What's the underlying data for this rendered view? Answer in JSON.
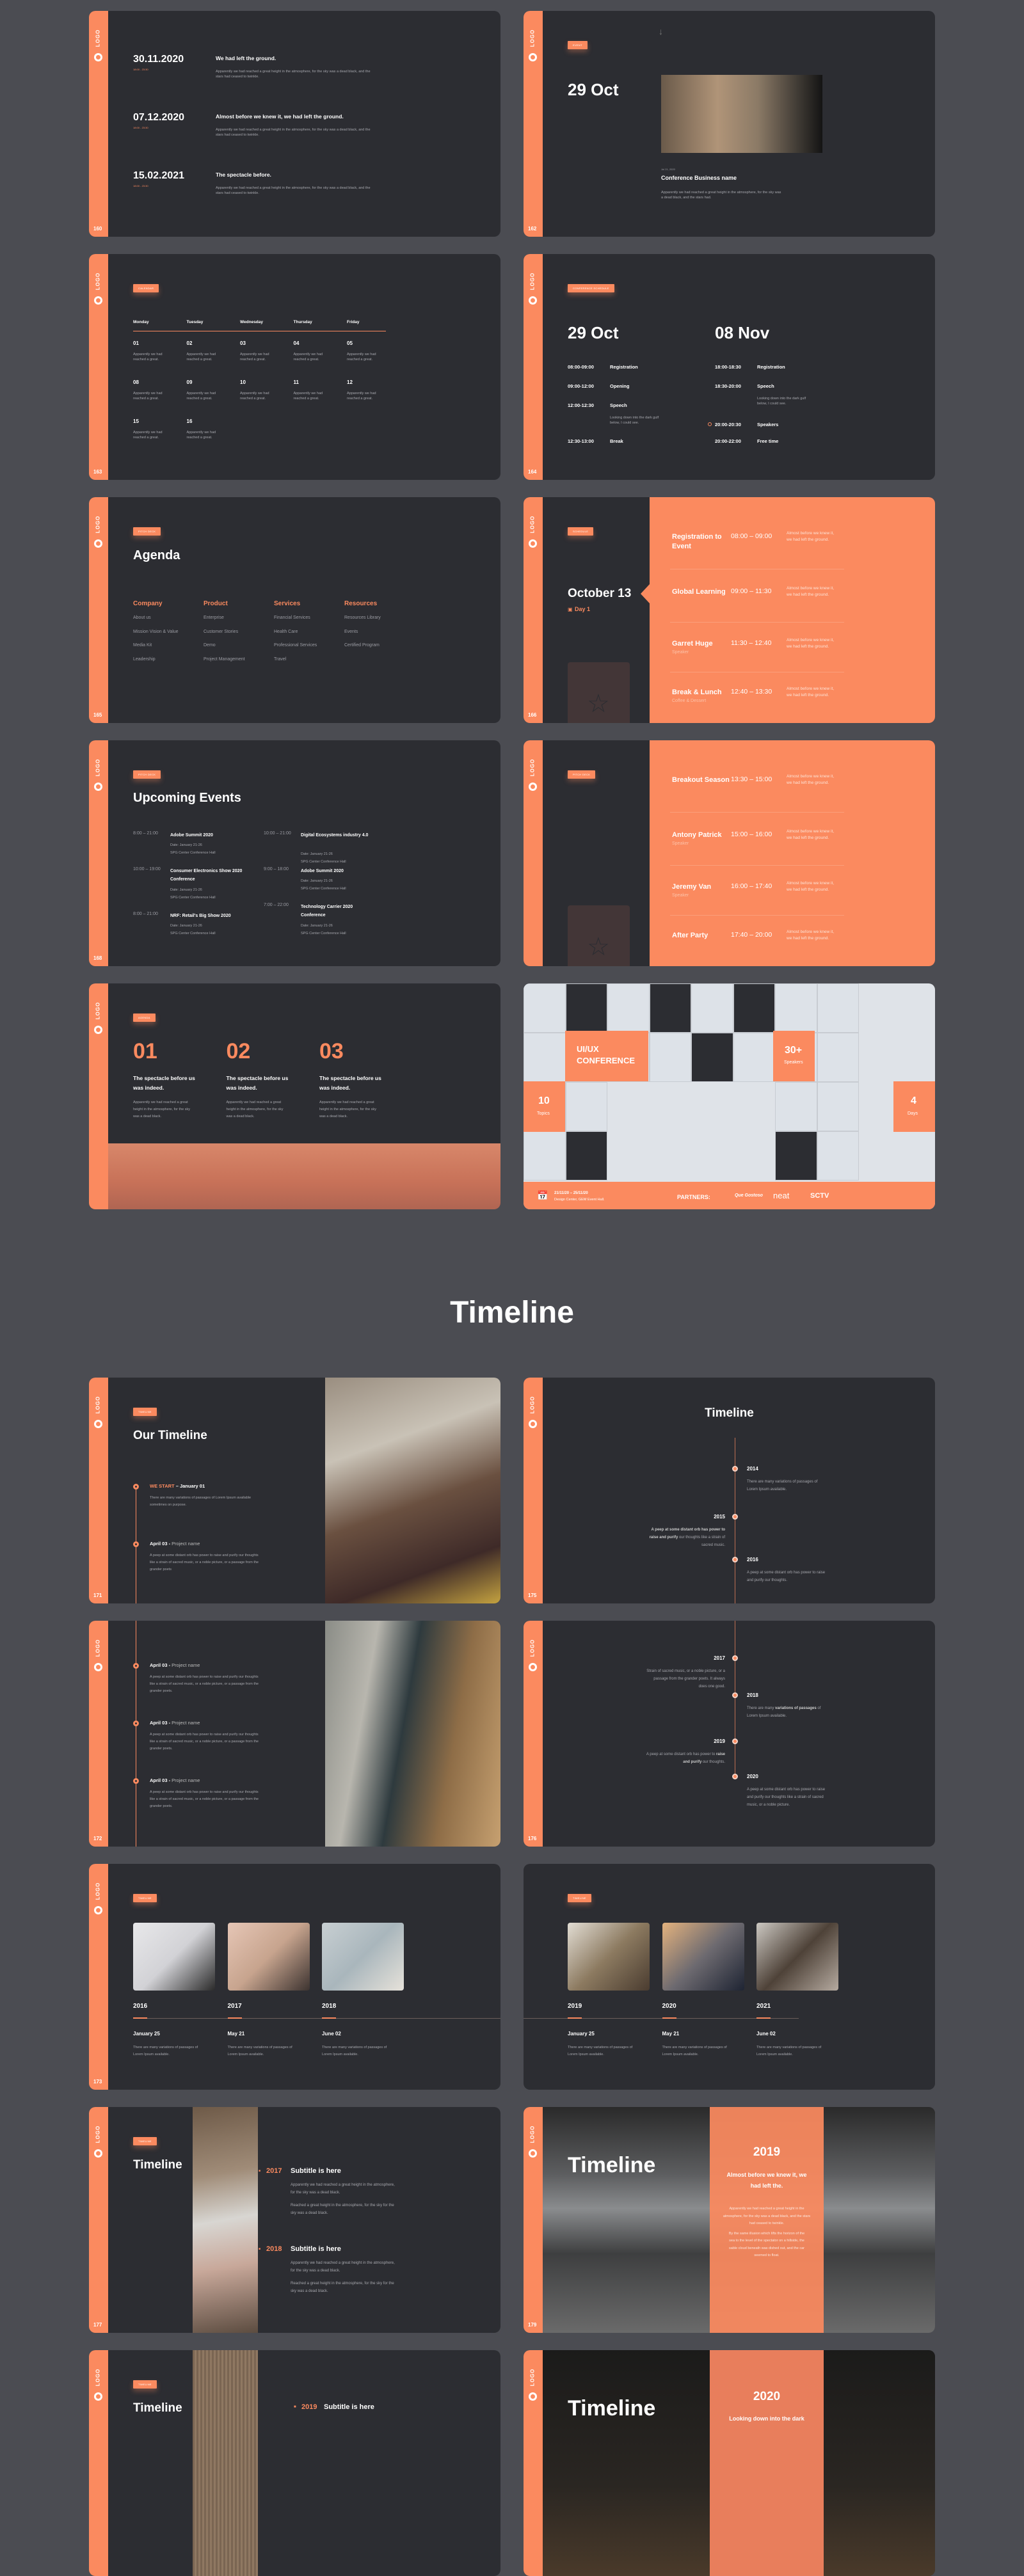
{
  "common": {
    "logo_text": "LOGO",
    "accent": "#fb8a5f",
    "bg_dark": "#2c2d32",
    "page_bg": "#4b4c52"
  },
  "s160": {
    "page": "160",
    "items": [
      {
        "date": "30.11.2020",
        "time": "18:00 - 23:30",
        "title": "We had left the ground.",
        "text": "Apparently we had reached a great height in the atmosphere, for the sky was a dead black, and the stars had ceased to twinkle."
      },
      {
        "date": "07.12.2020",
        "time": "18:00 - 23:30",
        "title": "Almost before we knew it, we had left the ground.",
        "text": "Apparently we had reached a great height in the atmosphere, for the sky was a dead black, and the stars had ceased to twinkle."
      },
      {
        "date": "15.02.2021",
        "time": "18:00 - 23:30",
        "title": "The spectacle  before.",
        "text": "Apparently we had reached a great height in the atmosphere, for the sky was a dead black, and the stars had ceased to twinkle."
      }
    ]
  },
  "s162": {
    "page": "162",
    "tag": "EVENT",
    "date": "29 Oct",
    "meta": "Jul 21, 2020",
    "title": "Conference Business name",
    "text": "Apparently we had reached a great height in the atmosphere, for the sky was a dead black, and the stars had."
  },
  "s163": {
    "page": "163",
    "tag": "CALENDAR",
    "days": [
      "Monday",
      "Tuesday",
      "Wednesday",
      "Thursday",
      "Friday"
    ],
    "cells": [
      {
        "n": "01",
        "t": "Apparently we had reached a great."
      },
      {
        "n": "02",
        "t": "Apparently we had reached a great."
      },
      {
        "n": "03",
        "t": "Apparently we had reached a great."
      },
      {
        "n": "04",
        "t": "Apparently we had reached a great."
      },
      {
        "n": "05",
        "t": "Apparently we had reached a great."
      },
      {
        "n": "08",
        "t": "Apparently we had reached a great."
      },
      {
        "n": "09",
        "t": "Apparently we had reached a great."
      },
      {
        "n": "10",
        "t": "Apparently we had reached a great."
      },
      {
        "n": "11",
        "t": "Apparently we had reached a great."
      },
      {
        "n": "12",
        "t": "Apparently we had reached a great."
      },
      {
        "n": "15",
        "t": "Apparently we had reached a great."
      },
      {
        "n": "16",
        "t": "Apparently we had reached a great."
      }
    ]
  },
  "s164": {
    "page": "164",
    "tag": "CONFERENCE SCHEDULE",
    "left": {
      "date": "29 Oct",
      "rows": [
        {
          "time": "08:00-09:00",
          "label": "Registration",
          "note": ""
        },
        {
          "time": "09:00-12:00",
          "label": "Opening",
          "note": ""
        },
        {
          "time": "12:00-12:30",
          "label": "Speech",
          "note": "Looking down into the dark gulf below, I could see."
        },
        {
          "time": "12:30-13:00",
          "label": "Break",
          "note": ""
        }
      ]
    },
    "right": {
      "date": "08 Nov",
      "rows": [
        {
          "time": "18:00-18:30",
          "label": "Registration",
          "note": ""
        },
        {
          "time": "18:30-20:00",
          "label": "Speech",
          "note": "Looking down into the dark gulf below, I could see."
        },
        {
          "time": "20:00-20:30",
          "label": "Speakers",
          "note": "",
          "active": true
        },
        {
          "time": "20:00-22:00",
          "label": "Free time",
          "note": ""
        }
      ]
    }
  },
  "s165": {
    "page": "165",
    "tag": "PITCH DECK",
    "title": "Agenda",
    "columns": [
      {
        "head": "Company",
        "items": [
          "About us",
          "Mission Vision & Value",
          "Media Kit",
          "Leadership"
        ]
      },
      {
        "head": "Product",
        "items": [
          "Enterprise",
          "Customer Stories",
          "Demo",
          "Project Management"
        ]
      },
      {
        "head": "Services",
        "items": [
          "Financial Services",
          "Health Care",
          "Professional Services",
          "Travel"
        ]
      },
      {
        "head": "Resources",
        "items": [
          "Resources Library",
          "Events",
          "Certified Program"
        ]
      }
    ]
  },
  "s166": {
    "page": "166",
    "tag": "SCHEDULE",
    "date": "October 13",
    "day": "Day 1",
    "rows": [
      {
        "title": "Registration to Event",
        "sub": "",
        "time": "08:00 – 09:00",
        "text": "Almost before we knew it, we had left the ground."
      },
      {
        "title": "Global Learning",
        "sub": "",
        "time": "09:00 – 11:30",
        "text": "Almost before we knew it, we had left the ground."
      },
      {
        "title": "Garret Huge",
        "sub": "Speaker",
        "time": "11:30 – 12:40",
        "text": "Almost before we knew it, we had left the ground."
      },
      {
        "title": "Break & Lunch",
        "sub": "Coffee & Dessert",
        "time": "12:40 – 13:30",
        "text": "Almost before we knew it, we had left the ground."
      }
    ]
  },
  "s168": {
    "page": "168",
    "tag": "PITCH DECK",
    "title": "Upcoming Events",
    "events": [
      {
        "time": "8:00 – 21:00",
        "title": "Adobe Summit 2020",
        "date": "Date: January 21-26",
        "place": "SPG Center Conference Hall"
      },
      {
        "time": "10:00 – 19:00",
        "title": "Consumer Electronics Show 2020 Conference",
        "date": "Date: January 21-26",
        "place": "SPG Center Conference Hall"
      },
      {
        "time": "8:00 – 21:00",
        "title": "NRF: Retail's Big Show 2020",
        "date": "Date: January 21-26",
        "place": "SPG Center Conference Hall"
      },
      {
        "time": "10:00 – 21:00",
        "title": "Digital Ecosystems industry 4.0",
        "date": "Date: January 21-26",
        "place": "SPG Center Conference Hall"
      },
      {
        "time": "9:00 – 18:00",
        "title": "Adobe Summit 2020",
        "date": "Date: January 21-26",
        "place": "SPG Center Conference Hall"
      },
      {
        "time": "7:00 – 22:00",
        "title": "Technology Carrier 2020 Conference",
        "date": "Date: January 21-26",
        "place": "SPG Center Conference Hall"
      }
    ]
  },
  "s167": {
    "tag": "PITCH DECK",
    "rows": [
      {
        "title": "Breakout Season",
        "sub": "",
        "time": "13:30 – 15:00",
        "text": "Almost before we knew it, we had left the ground."
      },
      {
        "title": "Antony Patrick",
        "sub": "Speaker",
        "time": "15:00 – 16:00",
        "text": "Almost before we knew it, we had left the ground."
      },
      {
        "title": "Jeremy Van",
        "sub": "Speaker",
        "time": "16:00 – 17:40",
        "text": "Almost before we knew it, we had left the ground."
      },
      {
        "title": "After Party",
        "sub": "",
        "time": "17:40 – 20:00",
        "text": "Almost before we knew it, we had left the ground."
      }
    ]
  },
  "s169": {
    "tag": "AGENDA",
    "items": [
      {
        "num": "01",
        "title": "The spectacle  before us was indeed.",
        "text": "Apparently we had reached a great height in the atmosphere, for the sky was a dead black."
      },
      {
        "num": "02",
        "title": "The spectacle  before us was indeed.",
        "text": "Apparently we had reached a great height in the atmosphere, for the sky was a dead black."
      },
      {
        "num": "03",
        "title": "The spectacle  before us was indeed.",
        "text": "Apparently we had reached a great height in the atmosphere, for the sky was a dead black."
      }
    ]
  },
  "s170": {
    "title_l1": "UI/UX",
    "title_l2": "CONFERENCE",
    "speakers_num": "30+",
    "speakers_label": "Speakers",
    "topics_num": "10",
    "topics_label": "Topics",
    "days_num": "4",
    "days_label": "Days",
    "dates": "21/11/20  – 25/11/20",
    "venue": "Design Center, GEM Event Hall.",
    "partners_label": "PARTNERS:",
    "partners": [
      "Que Gostoso",
      "neat",
      "SCTV"
    ]
  },
  "section": {
    "title": "Timeline"
  },
  "s171": {
    "page": "171",
    "tag": "TIMELINE",
    "title": "Our Timeline",
    "items": [
      {
        "lead": "WE START",
        "rest": " – January 01",
        "text": "There are many variations of passages of Lorem Ipsum available sometimes on purpose."
      },
      {
        "lead": "April 03 -",
        "rest": " Project name",
        "text": "A peep at some distant orb has power to raise and purify our thoughts like a strain of sacred music, or a noble picture, or a passage from the grander poets"
      }
    ]
  },
  "s175": {
    "page": "175",
    "title": "Timeline",
    "items": [
      {
        "year": "2014",
        "side": "right",
        "text": "There are many variations of passages of Lorem Ipsum available."
      },
      {
        "year": "2015",
        "side": "left",
        "bold": "A peep  at some distant orb has power to raise and purify",
        "text": " our thoughts like a strain of sacred music."
      },
      {
        "year": "2016",
        "side": "right",
        "text": "A peep at some distant orb has power to raise and purify our thoughts."
      }
    ]
  },
  "s172": {
    "page": "172",
    "items": [
      {
        "lead": "April 03 -",
        "rest": " Project name",
        "text": "A peep at some distant orb has power to raise and purify our thoughts like a strain of sacred music, or a noble picture, or a passage from the grander poets."
      },
      {
        "lead": "April 03 -",
        "rest": " Project name",
        "text": "A peep at some distant orb has power to raise and purify our thoughts like a strain of sacred music, or a noble picture, or a passage from the grander poets."
      },
      {
        "lead": "April 03 -",
        "rest": " Project name",
        "text": "A peep at some distant orb has power to raise and purify our thoughts like a strain of sacred music, or a noble picture, or a passage from the grander poets."
      }
    ]
  },
  "s176": {
    "page": "176",
    "items": [
      {
        "year": "2017",
        "side": "left",
        "text": "Strain of sacred music, or a noble picture, or a passage from the grander poets. It always does one good."
      },
      {
        "year": "2018",
        "side": "right",
        "pre": "There are many ",
        "bold": "variations of passages",
        "text": " of Lorem Ipsum available."
      },
      {
        "year": "2019",
        "side": "left",
        "pre": "A peep at some distant orb has power to ",
        "bold": "raise and purify",
        "text": " our thoughts."
      },
      {
        "year": "2020",
        "side": "right",
        "text": "A peep at some distant orb has power to raise and purify our thoughts like a strain of sacred music, or a noble picture."
      }
    ]
  },
  "s173": {
    "page": "173",
    "tag": "TIMELINE",
    "items": [
      {
        "year": "2016",
        "date": "January 25",
        "text": "There are many variations of passages of Lorem Ipsum available."
      },
      {
        "year": "2017",
        "date": "May 21",
        "text": "There are many variations of passages of Lorem Ipsum available."
      },
      {
        "year": "2018",
        "date": "June 02",
        "text": "There are many variations of passages of Lorem Ipsum available."
      }
    ]
  },
  "s174": {
    "tag": "TIMELINE",
    "items": [
      {
        "year": "2019",
        "date": "January 25",
        "text": "There are many variations of passages of Lorem Ipsum available."
      },
      {
        "year": "2020",
        "date": "May 21",
        "text": "There are many variations of passages of Lorem Ipsum available."
      },
      {
        "year": "2021",
        "date": "June 02",
        "text": "There are many variations of passages of Lorem Ipsum available."
      }
    ]
  },
  "s177": {
    "page": "177",
    "tag": "TIMELINE",
    "title": "Timeline",
    "items": [
      {
        "year": "2017",
        "sub": "Subtitle is here",
        "p1": "Apparently we had reached a great height in the atmosphere, for the sky was a dead black.",
        "p2": "Reached a great height in the atmosphere, for the sky for the sky was a dead black."
      },
      {
        "year": "2018",
        "sub": "Subtitle is here",
        "p1": "Apparently we had reached a great height in the atmosphere, for the sky was a dead black.",
        "p2": "Reached a great height in the atmosphere, for the sky for the sky was a dead black."
      }
    ]
  },
  "s179": {
    "page": "179",
    "title": "Timeline",
    "year": "2019",
    "headline": "Almost before we knew it, we had left the.",
    "p1": "Apparently we had reached a great height in the atmosphere, for the sky was a dead black, and the stars had ceased to twinkle.",
    "p2": "By the same illusion which lifts the horizon of the sea to the level of the spectator on a hillside, the sable cloud beneath was dished out, and the car seemed to float."
  },
  "s178": {
    "tag": "TIMELINE",
    "title": "Timeline",
    "year": "2019",
    "sub": "Subtitle is here"
  },
  "s180": {
    "title": "Timeline",
    "year": "2020",
    "teaser": "Looking down into the dark"
  }
}
